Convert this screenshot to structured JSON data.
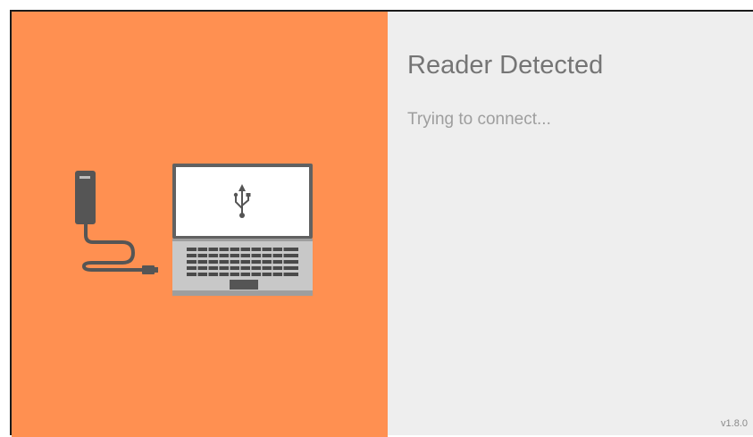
{
  "colors": {
    "left_background": "#ff9051",
    "right_background": "#eeeeee",
    "title_text": "#757575",
    "status_text": "#9e9e9e",
    "device_dark": "#555555",
    "laptop_base": "#c8c8c8",
    "laptop_bezel": "#616161"
  },
  "illustration": {
    "reader_icon": "card-reader-icon",
    "laptop_icon": "laptop-icon",
    "usb_icon": "usb-icon"
  },
  "main": {
    "title": "Reader Detected",
    "status": "Trying to connect..."
  },
  "footer": {
    "version": "v1.8.0"
  }
}
